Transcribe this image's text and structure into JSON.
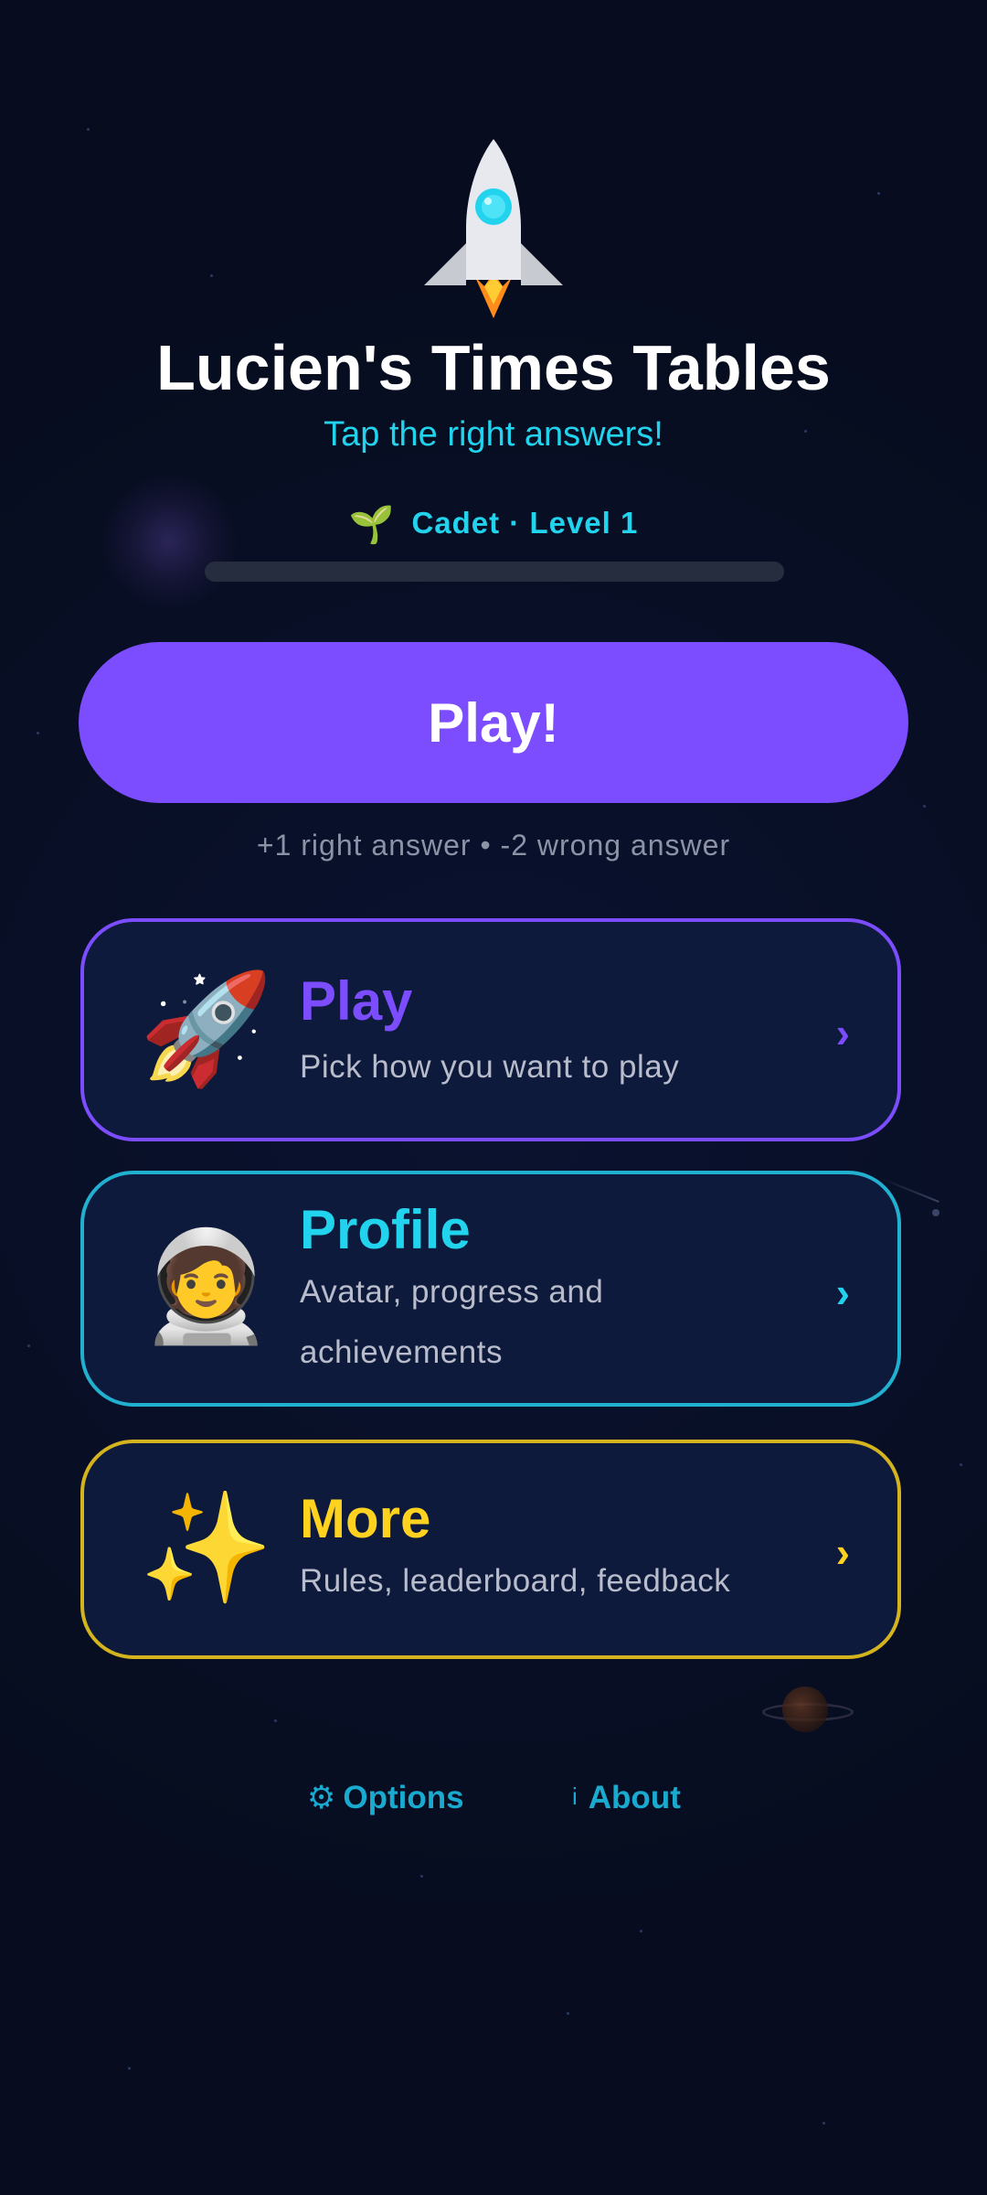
{
  "header": {
    "title": "Lucien's Times Tables",
    "subtitle": "Tap the right answers!"
  },
  "rank": {
    "icon": "sprout-icon",
    "label": "Cadet · Level 1",
    "progress": 0
  },
  "play_button": {
    "label": "Play!"
  },
  "score_rule": "+1 right answer • -2 wrong answer",
  "menu": [
    {
      "title": "Play",
      "subtitle": "Pick how you want to play",
      "icon": "rocket-icon",
      "color": "#7c4dff"
    },
    {
      "title": "Profile",
      "subtitle": "Avatar, progress and achievements",
      "icon": "astronaut-icon",
      "color": "#22d3ee"
    },
    {
      "title": "More",
      "subtitle": "Rules, leaderboard, feedback",
      "icon": "sparkles-icon",
      "color": "#ffd21f"
    }
  ],
  "footer": {
    "options_label": "Options",
    "about_label": "About"
  },
  "colors": {
    "background": "#070d1f",
    "accent_purple": "#7c4dff",
    "accent_cyan": "#22d3ee",
    "accent_yellow": "#ffd21f"
  }
}
